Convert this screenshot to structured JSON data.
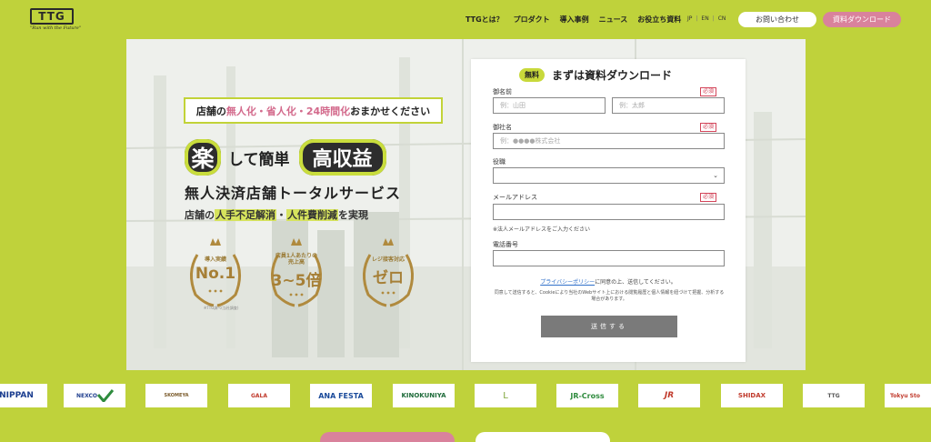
{
  "nav": {
    "logo_text": "TTG",
    "logo_tagline": "\"Run with the Future\"",
    "menu": [
      "TTGとは？",
      "プロダクト",
      "導入事例",
      "ニュース",
      "お役立ち資料"
    ],
    "languages": [
      "JP",
      "EN",
      "CN"
    ],
    "contact_label": "お問い合わせ",
    "download_label": "資料ダウンロード"
  },
  "hero": {
    "ribbon_pre": "店舗の",
    "ribbon_accent": "無人化・省人化・24時間化",
    "ribbon_post": "おまかせください",
    "head_char": "楽",
    "head_mid": "して簡単",
    "head_pill": "高収益",
    "subtitle": "無人決済店舗トータルサービス",
    "line_pre": "店舗の",
    "line_hl1": "人手不足解消",
    "line_sep": "・",
    "line_hl2": "人件費削減",
    "line_post": "を実現",
    "awards": [
      {
        "top": "導入実績",
        "big": "No.1"
      },
      {
        "top": "店員1人あたりの\n売上高",
        "big": "3~5倍"
      },
      {
        "top": "レジ接客対応",
        "big": "ゼロ"
      }
    ],
    "award_note": "※TTG調べ(当社調査)"
  },
  "form": {
    "free_badge": "無料",
    "title": "まずは資料ダウンロード",
    "required": "必須",
    "name_label": "御名前",
    "last_name_placeholder": "例：山田",
    "first_name_placeholder": "例：太郎",
    "company_label": "御社名",
    "company_placeholder": "例：●●●●株式会社",
    "position_label": "役職",
    "email_label": "メールアドレス",
    "email_hint": "※法人メールアドレスをご入力ください",
    "phone_label": "電話番号",
    "policy_link": "プライバシーポリシー",
    "policy_text": "に同意の上、送信してください。",
    "note": "同意して送信すると、Cookieにより当社のWebサイト上における閲覧履歴と個人情報を紐づけて把握、分析する場合があります。",
    "submit_label": "送信する"
  },
  "logos": [
    "NIPPAN",
    "NEXCO",
    "SKOMEYA",
    "GALA",
    "ANA FESTA",
    "KINOKUNIYA",
    "L",
    "JR-Cross",
    "JR",
    "SHIDAX",
    "TTG",
    "Tokyu Sto"
  ],
  "colors": {
    "lime": "#bfd23b",
    "pink": "#d9829c",
    "dark": "#2d2d2d",
    "gold": "#a67f36"
  }
}
